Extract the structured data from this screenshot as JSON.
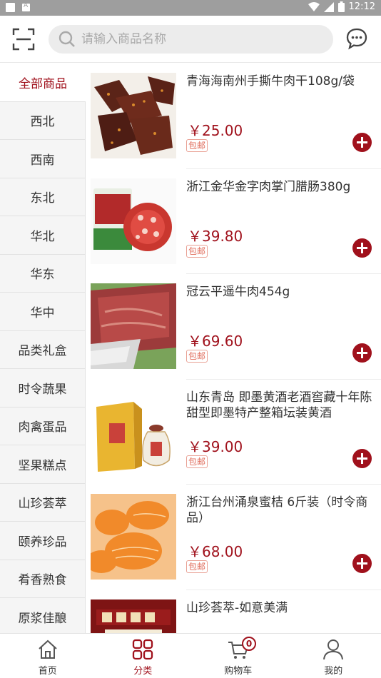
{
  "status_bar": {
    "time": "12:12"
  },
  "search": {
    "placeholder": "请输入商品名称"
  },
  "sidebar": {
    "items": [
      {
        "label": "全部商品",
        "active": true
      },
      {
        "label": "西北"
      },
      {
        "label": "西南"
      },
      {
        "label": "东北"
      },
      {
        "label": "华北"
      },
      {
        "label": "华东"
      },
      {
        "label": "华中"
      },
      {
        "label": "品类礼盒"
      },
      {
        "label": "时令蔬果"
      },
      {
        "label": "肉禽蛋品"
      },
      {
        "label": "坚果糕点"
      },
      {
        "label": "山珍荟萃"
      },
      {
        "label": "颐养珍品"
      },
      {
        "label": "肴香熟食"
      },
      {
        "label": "原浆佳酿"
      }
    ]
  },
  "products": [
    {
      "name": "青海海南州手撕牛肉干108g/袋",
      "price": "￥25.00",
      "tag": "包邮"
    },
    {
      "name": "浙江金华金字肉掌门腊肠380g",
      "price": "￥39.80",
      "tag": "包邮"
    },
    {
      "name": "冠云平遥牛肉454g",
      "price": "￥69.60",
      "tag": "包邮"
    },
    {
      "name": "山东青岛 即墨黄酒老酒窖藏十年陈甜型即墨特产整箱坛装黄酒",
      "price": "￥39.00",
      "tag": "包邮"
    },
    {
      "name": "浙江台州涌泉蜜桔 6斤装（时令商品）",
      "price": "￥68.00",
      "tag": "包邮"
    },
    {
      "name": "山珍荟萃-如意美满",
      "price": "",
      "tag": ""
    }
  ],
  "tabbar": {
    "items": [
      {
        "label": "首页"
      },
      {
        "label": "分类",
        "active": true
      },
      {
        "label": "购物车"
      },
      {
        "label": "我的"
      }
    ],
    "cart_count": "0"
  },
  "colors": {
    "accent": "#a0111c",
    "tag": "#e06b5a",
    "sidebar_bg": "#f5f5f5"
  }
}
